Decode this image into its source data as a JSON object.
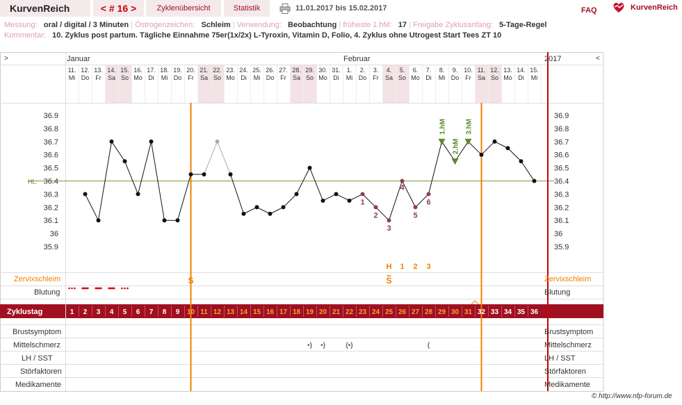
{
  "topbar": {
    "brand": "KurvenReich",
    "nav_label": "< # 16 >",
    "tab_overview": "Zyklenübersicht",
    "tab_stats": "Statistik",
    "date_range": "11.01.2017 bis 15.02.2017",
    "faq": "FAQ",
    "logo_text": "KurvenReich",
    "print_icon": "printer-icon"
  },
  "info": {
    "messung_label": "Messung:",
    "messung_value": "oral / digital / 3 Minuten",
    "oestrogen_label": "Östrogenzeichen:",
    "oestrogen_value": "Schleim",
    "verwendung_label": "Verwendung:",
    "verwendung_value": "Beobachtung",
    "frueheste_label": "früheste 1.hM:",
    "frueheste_value": "17",
    "freigabe_label": "Freigabe Zyklusanfang:",
    "freigabe_value": "5-Tage-Regel",
    "kommentar_label": "Kommentar:",
    "kommentar_value": "10. Zyklus post partum. Tägliche Einnahme 75er(1x/2x) L-Tyroxin, Vitamin D, Folio,  4. Zyklus ohne Utrogest Start Tees ZT 10"
  },
  "chart_header": {
    "left_arrow": ">",
    "right_arrow": "<",
    "month_jan": "Januar",
    "month_feb": "Februar",
    "year": "2017",
    "hl_label": "HL:"
  },
  "chart_data": {
    "type": "line",
    "days": [
      {
        "d": "11.",
        "w": "Mi"
      },
      {
        "d": "12.",
        "w": "Do"
      },
      {
        "d": "13.",
        "w": "Fr"
      },
      {
        "d": "14.",
        "w": "Sa"
      },
      {
        "d": "15.",
        "w": "So"
      },
      {
        "d": "16.",
        "w": "Mo"
      },
      {
        "d": "17.",
        "w": "Di"
      },
      {
        "d": "18.",
        "w": "Mi"
      },
      {
        "d": "19.",
        "w": "Do"
      },
      {
        "d": "20.",
        "w": "Fr"
      },
      {
        "d": "21.",
        "w": "Sa"
      },
      {
        "d": "22.",
        "w": "So"
      },
      {
        "d": "23.",
        "w": "Mo"
      },
      {
        "d": "24.",
        "w": "Di"
      },
      {
        "d": "25.",
        "w": "Mi"
      },
      {
        "d": "26.",
        "w": "Do"
      },
      {
        "d": "27.",
        "w": "Fr"
      },
      {
        "d": "28.",
        "w": "Sa"
      },
      {
        "d": "29.",
        "w": "So"
      },
      {
        "d": "30.",
        "w": "Mo"
      },
      {
        "d": "31.",
        "w": "Di"
      },
      {
        "d": "1.",
        "w": "Mi"
      },
      {
        "d": "2.",
        "w": "Do"
      },
      {
        "d": "3.",
        "w": "Fr"
      },
      {
        "d": "4.",
        "w": "Sa"
      },
      {
        "d": "5.",
        "w": "So"
      },
      {
        "d": "6.",
        "w": "Mo"
      },
      {
        "d": "7.",
        "w": "Di"
      },
      {
        "d": "8.",
        "w": "Mi"
      },
      {
        "d": "9.",
        "w": "Do"
      },
      {
        "d": "10.",
        "w": "Fr"
      },
      {
        "d": "11.",
        "w": "Sa"
      },
      {
        "d": "12.",
        "w": "So"
      },
      {
        "d": "13.",
        "w": "Mo"
      },
      {
        "d": "14.",
        "w": "Di"
      },
      {
        "d": "15.",
        "w": "Mi"
      }
    ],
    "cycle_days": [
      1,
      2,
      3,
      4,
      5,
      6,
      7,
      8,
      9,
      10,
      11,
      12,
      13,
      14,
      15,
      16,
      17,
      18,
      19,
      20,
      21,
      22,
      23,
      24,
      25,
      26,
      27,
      28,
      29,
      30,
      31,
      32,
      33,
      34,
      35,
      36
    ],
    "temperatures": [
      null,
      36.3,
      36.1,
      36.7,
      36.55,
      36.3,
      36.7,
      36.1,
      36.1,
      36.45,
      36.45,
      36.7,
      36.45,
      36.15,
      36.2,
      36.15,
      36.2,
      36.3,
      36.5,
      36.25,
      36.3,
      36.25,
      36.3,
      36.2,
      36.1,
      36.4,
      36.2,
      36.3,
      36.7,
      36.55,
      36.7,
      36.6,
      36.7,
      36.65,
      36.55,
      36.4
    ],
    "excluded_days": [
      12
    ],
    "y_ticks": [
      36.9,
      36.8,
      36.7,
      36.6,
      36.5,
      36.4,
      36.3,
      36.2,
      36.1,
      36,
      35.9
    ],
    "ylim": [
      35.85,
      36.98
    ],
    "hilfslinie": 36.4,
    "low_labels": [
      {
        "day": 23,
        "text": "1"
      },
      {
        "day": 24,
        "text": "2"
      },
      {
        "day": 25,
        "text": "3"
      },
      {
        "day": 26,
        "text": "4"
      },
      {
        "day": 27,
        "text": "5"
      },
      {
        "day": 28,
        "text": "6"
      }
    ],
    "high_labels": [
      {
        "day": 29,
        "text": "1.hM"
      },
      {
        "day": 30,
        "text": "2.hM"
      },
      {
        "day": 31,
        "text": "3.hM"
      }
    ],
    "cervix_top_labels": [
      {
        "day": 25,
        "text": "H"
      },
      {
        "day": 26,
        "text": "1"
      },
      {
        "day": 27,
        "text": "2"
      },
      {
        "day": 28,
        "text": "3"
      }
    ],
    "cervix_marks": [
      {
        "day": 10,
        "text": "S"
      },
      {
        "day": 25,
        "text": "S"
      }
    ],
    "bleeding": [
      {
        "day": 1,
        "type": "dots"
      },
      {
        "day": 2,
        "type": "dash"
      },
      {
        "day": 3,
        "type": "dash"
      },
      {
        "day": 4,
        "type": "dash"
      },
      {
        "day": 5,
        "type": "dots"
      }
    ],
    "mittelschmerz": [
      {
        "day": 19,
        "text": "•)"
      },
      {
        "day": 20,
        "text": "•)"
      },
      {
        "day": 22,
        "text": "(•)"
      },
      {
        "day": 28,
        "text": "("
      }
    ],
    "vertical_lines": [
      9.5,
      31.5
    ]
  },
  "rows": {
    "cervix": "Zervixschleim",
    "bleeding": "Blutung",
    "cycle_day": "Zyklustag",
    "breast": "Brustsymptom",
    "midpain": "Mittelschmerz",
    "lh": "LH / SST",
    "disturb": "Störfaktoren",
    "meds": "Medikamente"
  },
  "footer": {
    "copyright": "© http://www.nfp-forum.de"
  },
  "colors": {
    "accent": "#a01020",
    "orange": "#f08000",
    "green": "#5a8a2a",
    "weekend": "#f3e3e6",
    "lowmark": "#904050"
  }
}
